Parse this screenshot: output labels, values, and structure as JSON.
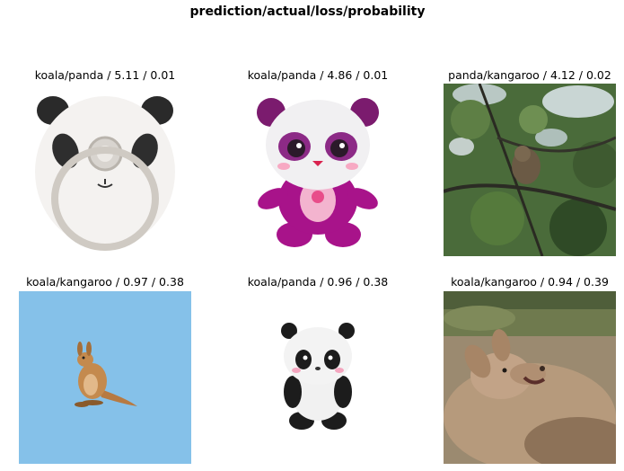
{
  "figure": {
    "title": "prediction/actual/loss/probability"
  },
  "panels": [
    {
      "title": "koala/panda / 5.11 / 0.01",
      "image": "panda-phone-ring-icon"
    },
    {
      "title": "koala/panda / 4.86 / 0.01",
      "image": "purple-panda-plush-icon"
    },
    {
      "title": "panda/kangaroo / 4.12 / 0.02",
      "image": "kangaroo-in-tree-photo"
    },
    {
      "title": "koala/kangaroo / 0.97 / 0.38",
      "image": "kangaroo-emoji-icon"
    },
    {
      "title": "koala/panda / 0.96 / 0.38",
      "image": "panda-lamp-toy-icon"
    },
    {
      "title": "koala/kangaroo / 0.94 / 0.39",
      "image": "kangaroo-closeup-photo"
    }
  ],
  "colors": {
    "emoji_background": "#85c1e9",
    "plush_purple": "#a8138a",
    "photo_green": "#4a6b3a",
    "kangaroo_brown": "#c48a4e"
  }
}
